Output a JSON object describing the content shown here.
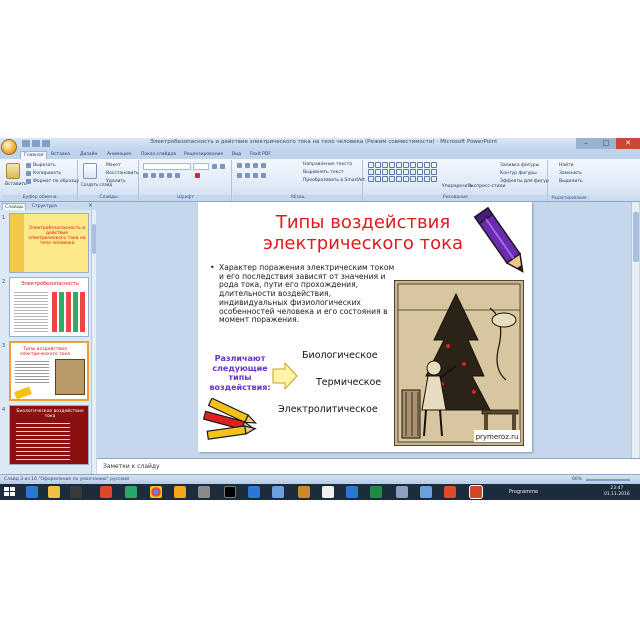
{
  "window": {
    "title": "Электробезопасность и действие электрического тока на тело человека (Режим совместимости) - Microsoft PowerPoint",
    "minimize": "–",
    "maximize": "□",
    "close": "✕"
  },
  "ribbon": {
    "tabs": [
      "Главная",
      "Вставка",
      "Дизайн",
      "Анимация",
      "Показ слайдов",
      "Рецензирование",
      "Вид",
      "Foxit PDF"
    ],
    "groups": {
      "clipboard": {
        "label": "Буфер обмена",
        "paste": "Вставить",
        "cut": "Вырезать",
        "copy": "Копировать",
        "format": "Формат по образцу"
      },
      "slides": {
        "label": "Слайды",
        "create": "Создать слайд",
        "layout": "Макет",
        "reset": "Восстановить",
        "delete": "Удалить"
      },
      "font": {
        "label": "Шрифт"
      },
      "paragraph": {
        "label": "Абзац",
        "text_direction": "Направление текста",
        "align_text": "Выровнять текст",
        "smartart": "Преобразовать в SmartArt"
      },
      "drawing": {
        "label": "Рисование",
        "arrange": "Упорядочить",
        "styles": "Экспресс-стили",
        "fill": "Заливка фигуры",
        "outline": "Контур фигуры",
        "effects": "Эффекты для фигур"
      },
      "editing": {
        "label": "Редактирование",
        "find": "Найти",
        "replace": "Заменить",
        "select": "Выделить"
      }
    }
  },
  "left_pane": {
    "tabs": [
      "Слайды",
      "Структура"
    ],
    "slides": [
      {
        "num": "1",
        "title": "Электробезопасность и действие электрического тока на тело человека",
        "bg": "#fde98a"
      },
      {
        "num": "2",
        "title": "Электробезопасность",
        "bg": "#ffffff"
      },
      {
        "num": "3",
        "title": "Типы воздействия электрического тока",
        "bg": "#ffffff"
      },
      {
        "num": "4",
        "title": "Биологическое воздействие тока",
        "bg": "#8b1010"
      }
    ]
  },
  "slide": {
    "title": "Типы воздействия электрического тока",
    "bullet": "Характер поражения электрическим током и его последствия зависят от значения и рода тока, пути его прохождения, длительности воздействия, индивидуальных физиологических особенностей человека и его состояния в момент поражения.",
    "kinds_label": "Различают следующие типы воздействия:",
    "kinds": [
      "Биологическое",
      "Термическое",
      "Электролитическое"
    ],
    "image_caption": "prymeroz.ru"
  },
  "notes": {
    "placeholder": "Заметки к слайду"
  },
  "status": {
    "left": "Слайд 3 из 16    \"Оформление по умолчанию\"    русский",
    "zoom": "66%"
  },
  "taskbar": {
    "tray_label": "Programme",
    "time": "23:47",
    "date": "01.11.2016"
  },
  "colors": {
    "title_red": "#e01a1a",
    "kinds_purple": "#6a34c8",
    "ribbon_bg": "#dde8f5",
    "taskbar": "#1c2c3c"
  }
}
